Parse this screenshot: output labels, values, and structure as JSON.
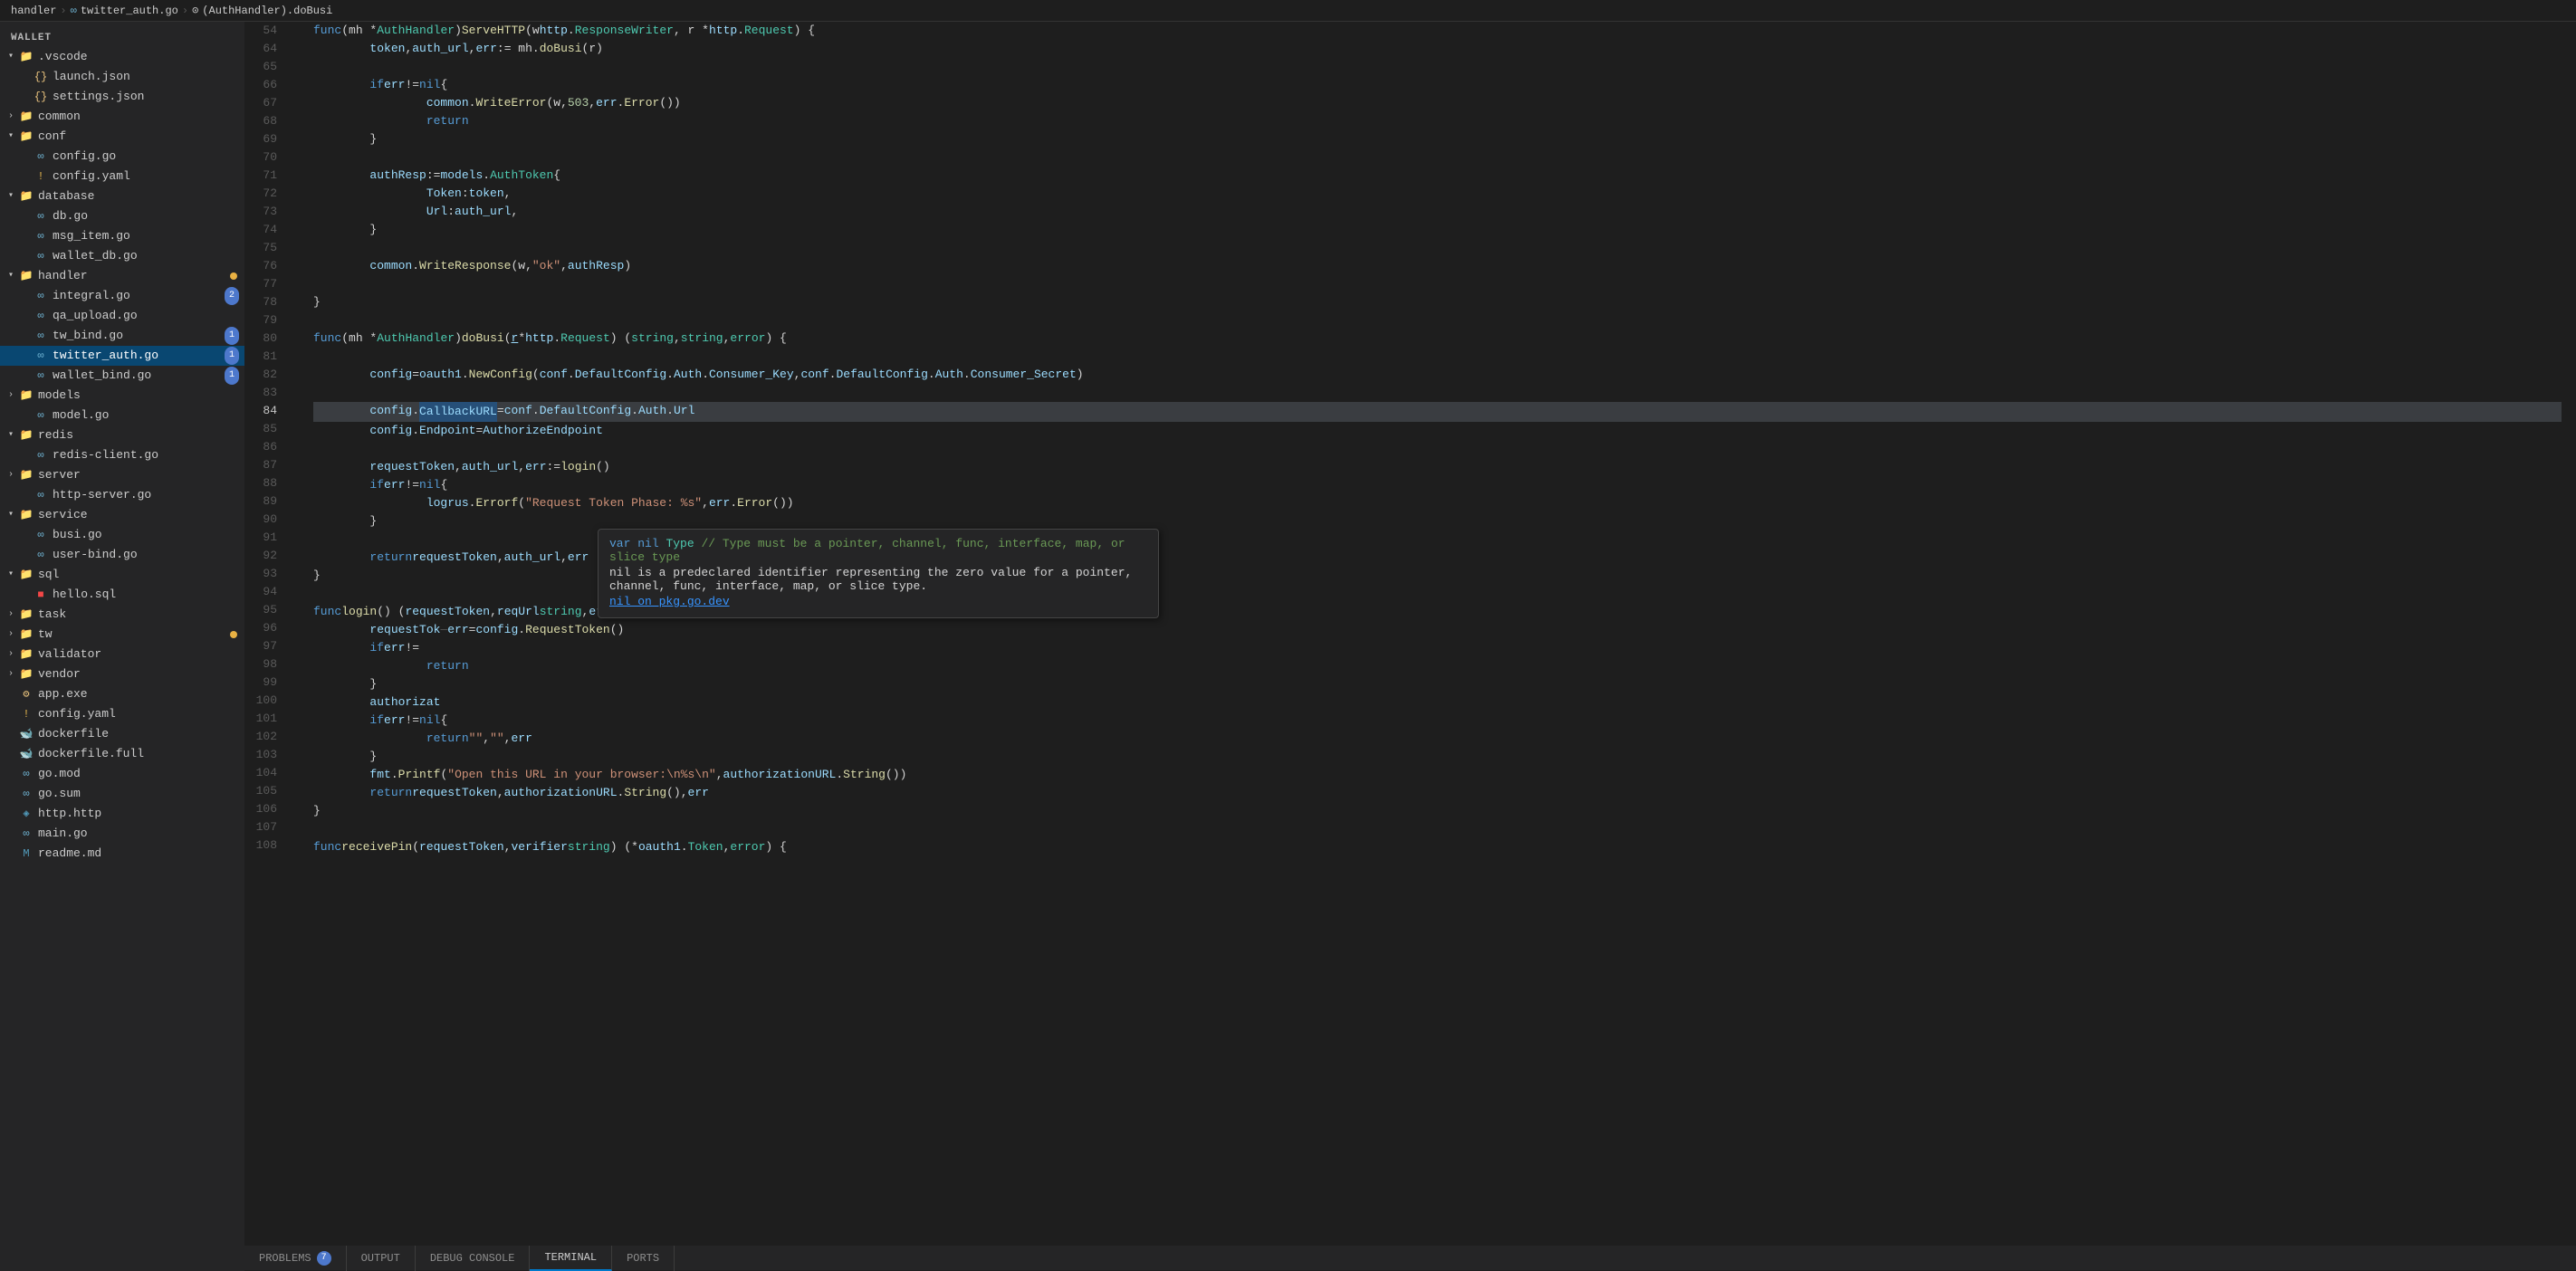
{
  "workspace": {
    "title": "WALLET"
  },
  "breadcrumb": {
    "parts": [
      {
        "label": "handler",
        "type": "folder"
      },
      {
        "label": "twitter_auth.go",
        "type": "file"
      },
      {
        "label": "(AuthHandler).doBusi",
        "type": "symbol"
      }
    ]
  },
  "sidebar": {
    "items": [
      {
        "id": "vscode-folder",
        "label": ".vscode",
        "type": "folder",
        "expanded": true,
        "depth": 0
      },
      {
        "id": "launch-json",
        "label": "launch.json",
        "type": "json",
        "depth": 1
      },
      {
        "id": "settings-json",
        "label": "settings.json",
        "type": "json",
        "depth": 1
      },
      {
        "id": "common-folder",
        "label": "common",
        "type": "folder",
        "depth": 0
      },
      {
        "id": "conf-folder",
        "label": "conf",
        "type": "folder",
        "expanded": true,
        "depth": 0
      },
      {
        "id": "config-go",
        "label": "config.go",
        "type": "go",
        "depth": 1
      },
      {
        "id": "config-yaml",
        "label": "config.yaml",
        "type": "yaml",
        "depth": 1
      },
      {
        "id": "database-folder",
        "label": "database",
        "type": "folder",
        "depth": 0
      },
      {
        "id": "db-go",
        "label": "db.go",
        "type": "go",
        "depth": 1
      },
      {
        "id": "msg-item-go",
        "label": "msg_item.go",
        "type": "go",
        "depth": 1
      },
      {
        "id": "wallet-db-go",
        "label": "wallet_db.go",
        "type": "go",
        "depth": 1
      },
      {
        "id": "handler-folder",
        "label": "handler",
        "type": "folder",
        "expanded": true,
        "depth": 0,
        "badge": ""
      },
      {
        "id": "integral-go",
        "label": "integral.go",
        "type": "go",
        "depth": 1,
        "badge": 2
      },
      {
        "id": "qa-upload-go",
        "label": "qa_upload.go",
        "type": "go",
        "depth": 1
      },
      {
        "id": "tw-bind-go",
        "label": "tw_bind.go",
        "type": "go",
        "depth": 1,
        "badge": 1
      },
      {
        "id": "twitter-auth-go",
        "label": "twitter_auth.go",
        "type": "go",
        "depth": 1,
        "active": true,
        "badge": 1
      },
      {
        "id": "wallet-bind-go",
        "label": "wallet_bind.go",
        "type": "go",
        "depth": 1,
        "badge": 1
      },
      {
        "id": "models-folder",
        "label": "models",
        "type": "folder",
        "depth": 0
      },
      {
        "id": "model-go",
        "label": "model.go",
        "type": "go",
        "depth": 1
      },
      {
        "id": "redis-folder",
        "label": "redis",
        "type": "folder",
        "expanded": true,
        "depth": 0
      },
      {
        "id": "redis-client-go",
        "label": "redis-client.go",
        "type": "go",
        "depth": 1
      },
      {
        "id": "server-folder",
        "label": "server",
        "type": "folder",
        "depth": 0
      },
      {
        "id": "http-server-go",
        "label": "http-server.go",
        "type": "go",
        "depth": 1
      },
      {
        "id": "service-folder",
        "label": "service",
        "type": "folder",
        "expanded": true,
        "depth": 0
      },
      {
        "id": "busi-go",
        "label": "busi.go",
        "type": "go",
        "depth": 1
      },
      {
        "id": "user-bind-go",
        "label": "user-bind.go",
        "type": "go",
        "depth": 1
      },
      {
        "id": "sql-folder",
        "label": "sql",
        "type": "folder",
        "expanded": true,
        "depth": 0
      },
      {
        "id": "hello-sql",
        "label": "hello.sql",
        "type": "sql",
        "depth": 1
      },
      {
        "id": "task-folder",
        "label": "task",
        "type": "folder",
        "depth": 0
      },
      {
        "id": "tw-folder",
        "label": "tw",
        "type": "folder",
        "depth": 0,
        "dot": "yellow"
      },
      {
        "id": "validator-folder",
        "label": "validator",
        "type": "folder",
        "depth": 0
      },
      {
        "id": "vendor-folder",
        "label": "vendor",
        "type": "folder",
        "depth": 0
      },
      {
        "id": "app-exe",
        "label": "app.exe",
        "type": "exe",
        "depth": 0
      },
      {
        "id": "config-yaml2",
        "label": "config.yaml",
        "type": "yaml",
        "depth": 0
      },
      {
        "id": "dockerfile",
        "label": "dockerfile",
        "type": "docker",
        "depth": 0
      },
      {
        "id": "dockerfile-full",
        "label": "dockerfile.full",
        "type": "docker",
        "depth": 0
      },
      {
        "id": "go-mod",
        "label": "go.mod",
        "type": "mod",
        "depth": 0
      },
      {
        "id": "go-sum",
        "label": "go.sum",
        "type": "mod",
        "depth": 0
      },
      {
        "id": "http-http",
        "label": "http.http",
        "type": "http",
        "depth": 0
      },
      {
        "id": "main-go",
        "label": "main.go",
        "type": "go",
        "depth": 0
      },
      {
        "id": "readme-md",
        "label": "readme.md",
        "type": "md",
        "depth": 0
      }
    ]
  },
  "code": {
    "lines": [
      {
        "num": 54,
        "content": "func (mh *AuthHandler) ServeHTTP(w http.ResponseWriter, r *http.Request) {"
      },
      {
        "num": 64,
        "content": "\ttoken, auth_url, err := mh.doBusi(r)"
      },
      {
        "num": 65,
        "content": ""
      },
      {
        "num": 66,
        "content": "\tif err != nil {"
      },
      {
        "num": 67,
        "content": "\t\tcommon.WriteError(w, 503, err.Error())"
      },
      {
        "num": 68,
        "content": "\t\treturn"
      },
      {
        "num": 69,
        "content": "\t}"
      },
      {
        "num": 70,
        "content": ""
      },
      {
        "num": 71,
        "content": "\tauthResp := models.AuthToken{"
      },
      {
        "num": 72,
        "content": "\t\tToken: token,"
      },
      {
        "num": 73,
        "content": "\t\tUrl:   auth_url,"
      },
      {
        "num": 74,
        "content": "\t}"
      },
      {
        "num": 75,
        "content": ""
      },
      {
        "num": 76,
        "content": "\tcommon.WriteResponse(w, \"ok\", authResp)"
      },
      {
        "num": 77,
        "content": ""
      },
      {
        "num": 78,
        "content": "}"
      },
      {
        "num": 79,
        "content": ""
      },
      {
        "num": 80,
        "content": "func (mh *AuthHandler) doBusi(r *http.Request) (string, string, error) {"
      },
      {
        "num": 81,
        "content": ""
      },
      {
        "num": 82,
        "content": "\tconfig = oauth1.NewConfig(conf.DefaultConfig.Auth.Consumer_Key, conf.DefaultConfig.Auth.Consumer_Secret)"
      },
      {
        "num": 83,
        "content": ""
      },
      {
        "num": 84,
        "content": "\tconfig.CallbackURL = conf.DefaultConfig.Auth.Url",
        "highlight": "CallbackURL"
      },
      {
        "num": 85,
        "content": "\tconfig.Endpoint = AuthorizeEndpoint"
      },
      {
        "num": 86,
        "content": ""
      },
      {
        "num": 87,
        "content": "\trequestToken, auth_url, err := login()"
      },
      {
        "num": 88,
        "content": "\tif err != nil {"
      },
      {
        "num": 89,
        "content": "\t\tlogrus.Errorf(\"Request Token Phase: %s\", err.Error())"
      },
      {
        "num": 90,
        "content": "\t}"
      },
      {
        "num": 91,
        "content": ""
      },
      {
        "num": 92,
        "content": "\treturn requestToken, auth_url, err"
      },
      {
        "num": 93,
        "content": "}"
      },
      {
        "num": 94,
        "content": ""
      },
      {
        "num": 95,
        "content": "func login() (requestToken, reqUrl string, err error) {"
      },
      {
        "num": 96,
        "content": "\trequestTok...    err = config.RequestToken()"
      },
      {
        "num": 97,
        "content": "\tif err !="
      },
      {
        "num": 98,
        "content": "\t\treturn"
      },
      {
        "num": 99,
        "content": "\t}"
      },
      {
        "num": 100,
        "content": "\tauthorizat"
      },
      {
        "num": 101,
        "content": "\tif err != nil {"
      },
      {
        "num": 102,
        "content": "\t\treturn \"\", \"\", err"
      },
      {
        "num": 103,
        "content": "\t}"
      },
      {
        "num": 104,
        "content": "\tfmt.Printf(\"Open this URL in your browser:\\n%s\\n\", authorizationURL.String())"
      },
      {
        "num": 105,
        "content": "\treturn requestToken, authorizationURL.String(), err"
      },
      {
        "num": 106,
        "content": "}"
      },
      {
        "num": 107,
        "content": ""
      },
      {
        "num": 108,
        "content": "func receivePin(requestToken, verifier string) (*oauth1.Token, error) {"
      }
    ]
  },
  "tooltip": {
    "lines": [
      {
        "text": "var nil Type   // Type must be a pointer, channel, func, interface, map, or slice type",
        "type": "code"
      },
      {
        "text": "nil is a predeclared identifier representing the zero value for a pointer, channel, func, interface, map, or slice type.",
        "type": "text"
      },
      {
        "text": "nil on pkg.go.dev",
        "type": "link"
      }
    ]
  },
  "bottom_tabs": [
    {
      "label": "PROBLEMS",
      "badge": 7
    },
    {
      "label": "OUTPUT"
    },
    {
      "label": "DEBUG CONSOLE"
    },
    {
      "label": "TERMINAL",
      "active": true
    },
    {
      "label": "PORTS"
    }
  ]
}
